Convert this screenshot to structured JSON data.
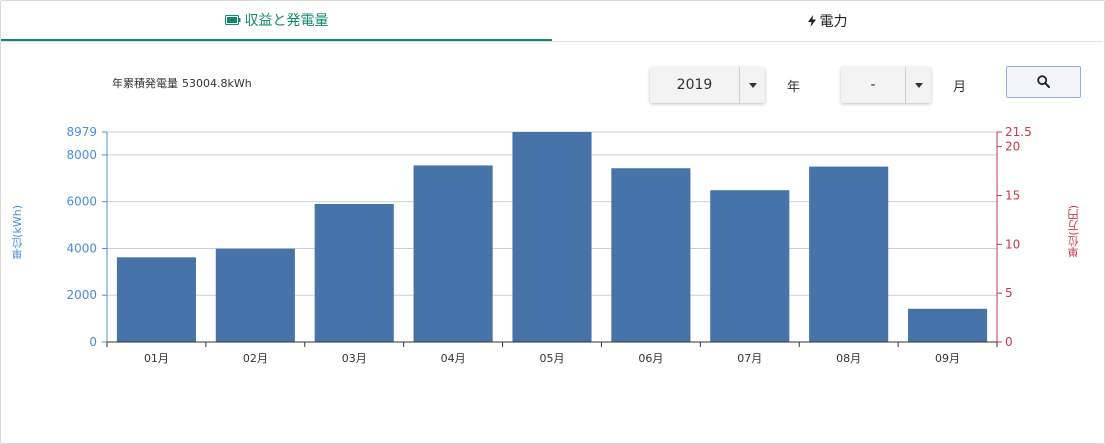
{
  "tabs": [
    {
      "label": "収益と発電量",
      "icon": "battery-icon",
      "active": true
    },
    {
      "label": "電力",
      "icon": "lightning-icon",
      "active": false
    }
  ],
  "summary": {
    "label": "年累積発電量",
    "value": "53004.8kWh"
  },
  "controls": {
    "year_value": "2019",
    "year_unit": "年",
    "month_value": "-",
    "month_unit": "月",
    "search_icon": "search-icon"
  },
  "colors": {
    "accent": "#0f8a70",
    "bar": "#4674a8",
    "left_axis": "#4a8fd9",
    "right_axis": "#c8394f"
  },
  "chart_data": {
    "type": "bar",
    "categories": [
      "01月",
      "02月",
      "03月",
      "04月",
      "05月",
      "06月",
      "07月",
      "08月",
      "09月"
    ],
    "values": [
      3620,
      3990,
      5900,
      7550,
      8979,
      7430,
      6490,
      7500,
      1420
    ],
    "ylabel": "単位(kWh)",
    "ylim": [
      0,
      8979
    ],
    "yticks": [
      "0",
      "2000",
      "4000",
      "6000",
      "8000",
      "8979"
    ],
    "y2label": "単位(万円)",
    "y2lim": [
      0,
      21.5
    ],
    "y2ticks": [
      "0",
      "5",
      "10",
      "15",
      "20",
      "21.5"
    ],
    "grid": true
  }
}
